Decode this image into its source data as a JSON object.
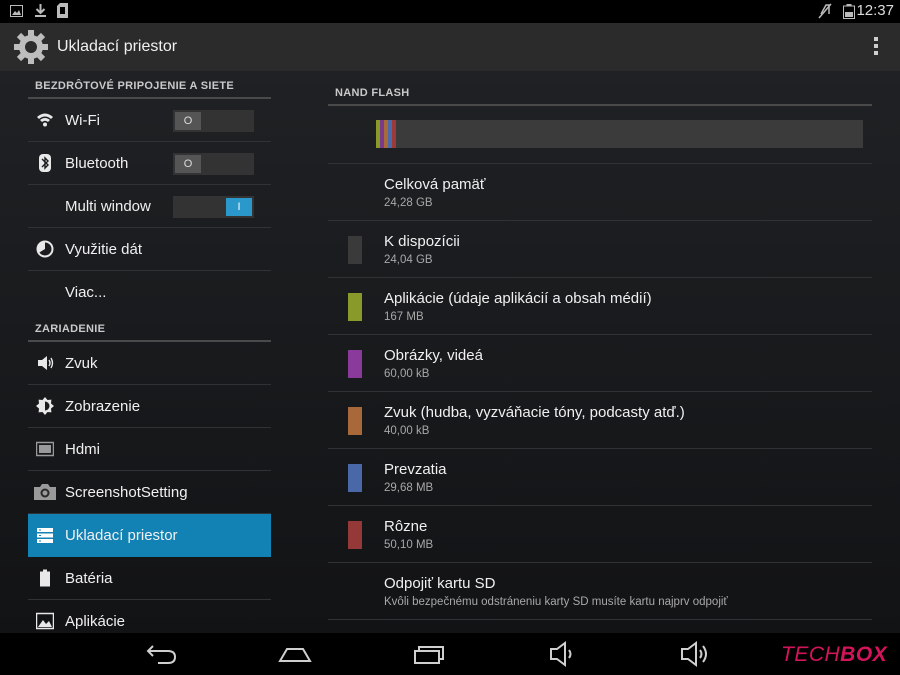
{
  "status_bar": {
    "time": "12:37",
    "left_icons": [
      "image-icon",
      "download-icon",
      "sd-card-icon"
    ],
    "right_icons": [
      "mute-icon",
      "battery-icon"
    ]
  },
  "action_bar": {
    "title": "Ukladací priestor",
    "icon": "settings-gear-icon"
  },
  "left_panel": {
    "sections": [
      {
        "header": "BEZDRÔTOVÉ PRIPOJENIE A SIETE",
        "items": [
          {
            "label": "Wi-Fi",
            "icon": "wifi-icon",
            "toggle": "O"
          },
          {
            "label": "Bluetooth",
            "icon": "bluetooth-icon",
            "toggle": "O"
          },
          {
            "label": "Multi window",
            "icon": "",
            "toggle": "I"
          },
          {
            "label": "Využitie dát",
            "icon": "data-usage-icon"
          },
          {
            "label": "Viac...",
            "icon": ""
          }
        ]
      },
      {
        "header": "ZARIADENIE",
        "items": [
          {
            "label": "Zvuk",
            "icon": "speaker-icon"
          },
          {
            "label": "Zobrazenie",
            "icon": "brightness-icon"
          },
          {
            "label": "Hdmi",
            "icon": "hdmi-icon"
          },
          {
            "label": "ScreenshotSetting",
            "icon": "camera-icon"
          },
          {
            "label": "Ukladací priestor",
            "icon": "storage-icon",
            "selected": true
          },
          {
            "label": "Batéria",
            "icon": "battery-icon"
          },
          {
            "label": "Aplikácie",
            "icon": "apps-icon"
          }
        ]
      }
    ]
  },
  "right_panel": {
    "header": "NAND FLASH",
    "bar_segments": [
      {
        "color": "#8a9a2a",
        "fraction": 0.007
      },
      {
        "color": "#7a3a8a",
        "fraction": 0.003
      },
      {
        "color": "#a86a3a",
        "fraction": 0.003
      },
      {
        "color": "#4a6aa8",
        "fraction": 0.003
      },
      {
        "color": "#9a3a3a",
        "fraction": 0.003
      }
    ],
    "items": [
      {
        "title": "Celková pamäť",
        "subtitle": "24,28 GB",
        "color": ""
      },
      {
        "title": "K dispozícii",
        "subtitle": "24,04 GB",
        "color": "#3a3a3a"
      },
      {
        "title": "Aplikácie (údaje aplikácií a obsah médií)",
        "subtitle": "167 MB",
        "color": "#8a9a2a"
      },
      {
        "title": "Obrázky, videá",
        "subtitle": "60,00 kB",
        "color": "#8a3a9a"
      },
      {
        "title": "Zvuk (hudba, vyzváňacie tóny, podcasty atď.)",
        "subtitle": "40,00 kB",
        "color": "#a8683a"
      },
      {
        "title": "Prevzatia",
        "subtitle": "29,68 MB",
        "color": "#4a68a8"
      },
      {
        "title": "Rôzne",
        "subtitle": "50,10 MB",
        "color": "#943838"
      },
      {
        "title": "Odpojiť kartu SD",
        "subtitle": "Kvôli bezpečnému odstráneniu karty SD musíte kartu najprv odpojiť",
        "color": ""
      }
    ]
  },
  "nav_bar": {
    "buttons": [
      "back-icon",
      "home-icon",
      "recents-icon",
      "volume-down-icon",
      "volume-up-icon"
    ]
  },
  "watermark": {
    "part1": "TECH",
    "part2": "BOX",
    "color": "#d4145a"
  }
}
